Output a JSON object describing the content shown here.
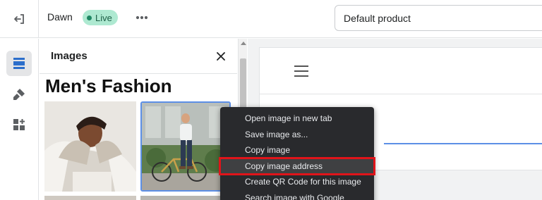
{
  "topbar": {
    "theme_name": "Dawn",
    "live_badge": "Live",
    "product_select_value": "Default product"
  },
  "panel": {
    "title": "Images",
    "collection_title": "Men's Fashion"
  },
  "context_menu": {
    "items": [
      "Open image in new tab",
      "Save image as...",
      "Copy image",
      "Copy image address",
      "Create QR Code for this image",
      "Search image with Google"
    ],
    "highlighted_index": 3
  },
  "colors": {
    "live_badge_bg": "#aee9d1",
    "selection_outline": "#5c8fe6",
    "menu_bg": "#292a2d",
    "highlight_box": "#e0141a"
  },
  "icons": [
    "exit-icon",
    "more-horizontal-icon",
    "sections-icon",
    "theme-settings-icon",
    "app-blocks-icon",
    "close-icon",
    "hamburger-icon"
  ]
}
